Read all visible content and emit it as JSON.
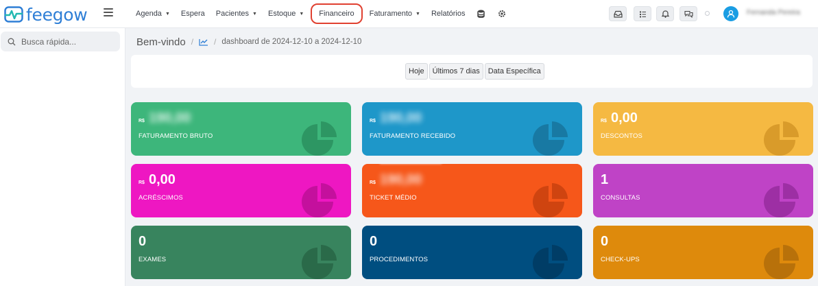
{
  "app": {
    "logo_text": "feegow"
  },
  "nav": {
    "items": [
      {
        "label": "Agenda",
        "caret": true
      },
      {
        "label": "Espera",
        "caret": false
      },
      {
        "label": "Pacientes",
        "caret": true
      },
      {
        "label": "Estoque",
        "caret": true
      },
      {
        "label": "Financeiro",
        "caret": false
      },
      {
        "label": "Faturamento",
        "caret": true
      },
      {
        "label": "Relatórios",
        "caret": false
      }
    ]
  },
  "user": {
    "name": "Fernanda Pereira"
  },
  "sidebar": {
    "search_placeholder": "Busca rápida..."
  },
  "breadcrumb": {
    "title": "Bem-vindo",
    "separator": "/",
    "text": "dashboard de 2024-12-10 a 2024-12-10"
  },
  "filters": {
    "buttons": [
      "Hoje",
      "Últimos 7 dias",
      "Data Específica"
    ]
  },
  "cards": [
    {
      "id": "faturamento-bruto",
      "label": "FATURAMENTO BRUTO",
      "currency": "R$",
      "value": "190,00",
      "blurred": true,
      "color": "#3db67b",
      "pie_color": "#2d9663"
    },
    {
      "id": "faturamento-recebido",
      "label": "FATURAMENTO RECEBIDO",
      "currency": "R$",
      "value": "190,00",
      "blurred": true,
      "color": "#1e97c9",
      "pie_color": "#1879a3"
    },
    {
      "id": "descontos",
      "label": "DESCONTOS",
      "currency": "R$",
      "value": "0,00",
      "blurred": false,
      "color": "#f5b942",
      "pie_color": "#d99b2a"
    },
    {
      "id": "acrescimos",
      "label": "ACRÉSCIMOS",
      "currency": "R$",
      "value": "0,00",
      "blurred": false,
      "color": "#ee17c2",
      "pie_color": "#c4109d"
    },
    {
      "id": "ticket-medio",
      "label": "TICKET MÉDIO",
      "currency": "R$",
      "value": "190,00",
      "blurred": true,
      "color": "#f6571a",
      "pie_color": "#cf4410"
    },
    {
      "id": "consultas",
      "label": "CONSULTAS",
      "currency": "",
      "value": "1",
      "blurred": false,
      "color": "#bf43c6",
      "pie_color": "#9d2fa4"
    },
    {
      "id": "exames",
      "label": "EXAMES",
      "currency": "",
      "value": "0",
      "blurred": false,
      "color": "#38845e",
      "pie_color": "#2a6a49"
    },
    {
      "id": "procedimentos",
      "label": "PROCEDIMENTOS",
      "currency": "",
      "value": "0",
      "blurred": false,
      "color": "#004e80",
      "pie_color": "#003d66"
    },
    {
      "id": "check-ups",
      "label": "CHECK-UPS",
      "currency": "",
      "value": "0",
      "blurred": false,
      "color": "#de8a0c",
      "pie_color": "#b8710a"
    }
  ]
}
